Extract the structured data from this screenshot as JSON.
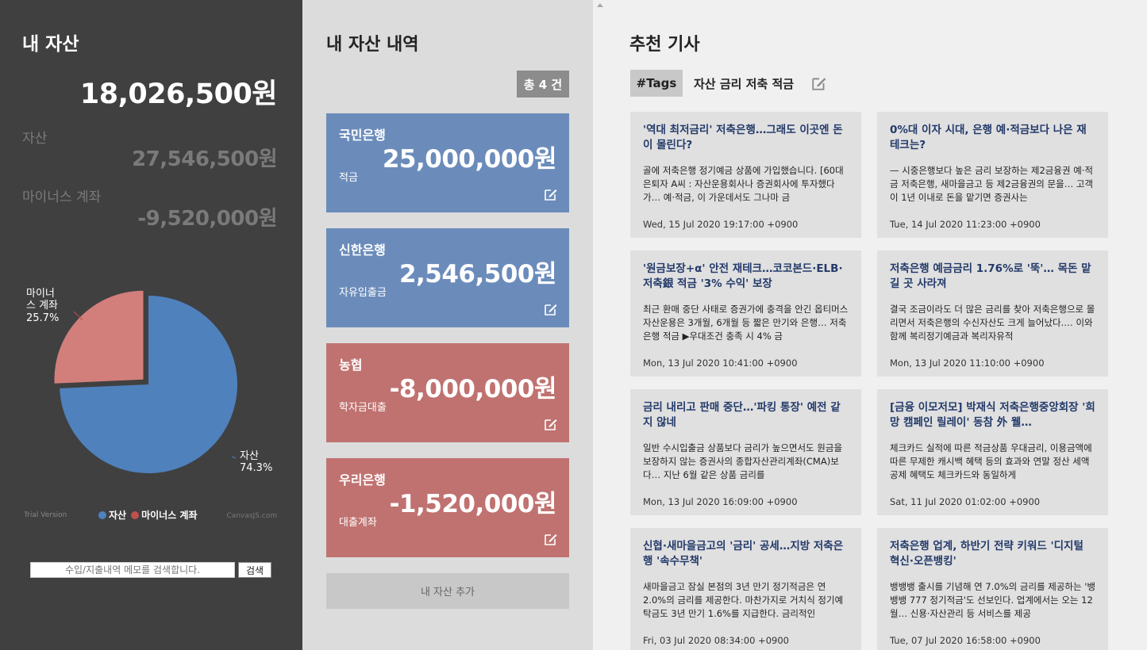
{
  "summary": {
    "title": "내 자산",
    "total": "18,026,500원",
    "asset_label": "자산",
    "asset_value": "27,546,500원",
    "minus_label": "마이너스 계좌",
    "minus_value": "-9,520,000원"
  },
  "chart_data": {
    "type": "pie",
    "slices": [
      {
        "name": "자산",
        "label_line1": "자산",
        "label_line2": "74.3%",
        "value": 74.3,
        "color": "#4f81bd"
      },
      {
        "name": "마이너스 계좌",
        "label_line1": "마이너",
        "label_line1b": "스 계좌",
        "label_line2": "25.7%",
        "value": 25.7,
        "color": "#c0504d"
      }
    ],
    "legend": [
      "자산",
      "마이너스 계좌"
    ],
    "trial_text": "Trial Version",
    "watermark": "CanvasJS.com"
  },
  "search": {
    "placeholder": "수입/지출내역 메모를 검색합니다.",
    "button": "검색"
  },
  "history": {
    "title": "내 자산 내역",
    "count": "총 4 건",
    "accounts": [
      {
        "bank": "국민은행",
        "amount": "25,000,000원",
        "type": "적금",
        "color": "blue"
      },
      {
        "bank": "신한은행",
        "amount": "2,546,500원",
        "type": "자유입출금",
        "color": "blue"
      },
      {
        "bank": "농협",
        "amount": "-8,000,000원",
        "type": "학자금대출",
        "color": "red"
      },
      {
        "bank": "우리은행",
        "amount": "-1,520,000원",
        "type": "대출계좌",
        "color": "red"
      }
    ],
    "add_button": "내 자산 추가"
  },
  "articles": {
    "title": "추천 기사",
    "tags_label": "#Tags",
    "tags": "자산 금리 저축 적금",
    "items": [
      {
        "title": "'역대 최저금리' 저축은행…그래도 이곳엔 돈이 몰린다?",
        "body": "골에 저축은행 정기예금 상품에 가입했습니다. [60대 은퇴자 A씨 : 자산운용회사나 증권회사에 투자했다가… 예·적금, 이 가운데서도 그나마 금",
        "date": "Wed, 15 Jul 2020 19:17:00 +0900"
      },
      {
        "title": "0%대 이자 시대, 은행 예·적금보다 나은 재테크는?",
        "body": "— 시중은행보다 높은 금리 보장하는 제2금융권 예·적금 저축은행, 새마을금고 등 제2금융권의 문을… 고객이 1년 이내로 돈을 맡기면 증권사는",
        "date": "Tue, 14 Jul 2020 11:23:00 +0900"
      },
      {
        "title": "'원금보장+α' 안전 재테크…코코본드·ELB·저축銀 적금 '3% 수익' 보장",
        "body": "최근 환매 중단 사태로 증권가에 충격을 안긴 옵티머스자산운용은 3개월, 6개월 등 짧은 만기와 은행… 저축은행 적금 ▶우대조건 충족 시 4% 금",
        "date": "Mon, 13 Jul 2020 10:41:00 +0900"
      },
      {
        "title": "저축은행 예금금리 1.76%로 '뚝'… 목돈 맡길 곳 사라져",
        "body": "결국 조금이라도 더 많은 금리를 찾아 저축은행으로 몰리면서 저축은행의 수신자산도 크게 늘어났다.… 이와 함께 복리정기예금과 복리자유적",
        "date": "Mon, 13 Jul 2020 11:10:00 +0900"
      },
      {
        "title": "금리 내리고 판매 중단…'파킹 통장' 예전 같지 않네",
        "body": "일반 수시입출금 상품보다 금리가 높으면서도 원금을 보장하지 않는 증권사의 종합자산관리계좌(CMA)보다… 지난 6월 같은 상품 금리를",
        "date": "Mon, 13 Jul 2020 16:09:00 +0900"
      },
      {
        "title": "[금융 이모저모] 박재식 저축은행중앙회장 '희망 캠페인 릴레이' 동참 外 웰…",
        "body": "체크카드 실적에 따른 적금상품 우대금리, 이용금액에 따른 무제한 캐시백 혜택 등의 효과와 연말 정산 세액 공제 혜택도 체크카드와 동일하게",
        "date": "Sat, 11 Jul 2020 01:02:00 +0900"
      },
      {
        "title": "신협·새마을금고의 '금리' 공세…지방 저축은행 '속수무책'",
        "body": "새마을금고 잠실 본점의 3년 만기 정기적금은 연 2.0%의 금리를 제공한다. 마찬가지로 거치식 정기예탁금도 3년 만기 1.6%를 지급한다. 금리적인",
        "date": "Fri, 03 Jul 2020 08:34:00 +0900"
      },
      {
        "title": "저축은행 업계, 하반기 전략 키워드 '디지털 혁신·오픈뱅킹'",
        "body": "뱅뱅뱅 출시를 기념해 연 7.0%의 금리를 제공하는 '뱅뱅뱅 777 정기적금'도 선보인다. 업계에서는 오는 12월… 신용·자산관리 등 서비스를 제공",
        "date": "Tue, 07 Jul 2020 16:58:00 +0900"
      }
    ]
  }
}
